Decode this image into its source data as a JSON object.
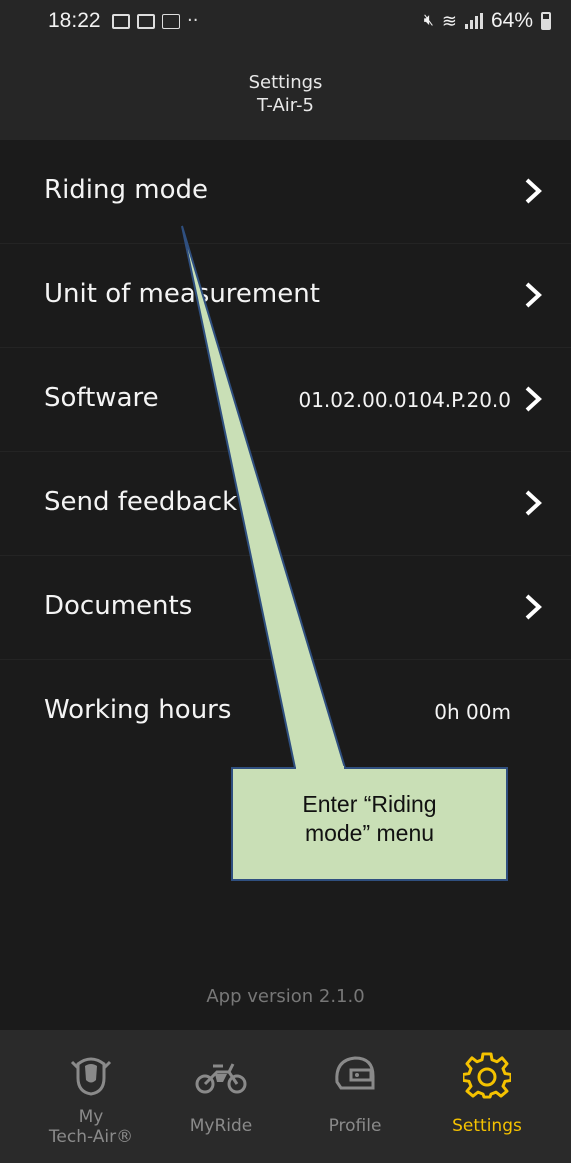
{
  "status_bar": {
    "time": "18:22",
    "battery": "64%",
    "icons_left": [
      "gallery-icon",
      "news-icon",
      "tech-air-icon"
    ],
    "dots": "··"
  },
  "header": {
    "title": "Settings",
    "subtitle": "T-Air-5"
  },
  "menu": {
    "riding_mode": "Riding mode",
    "unit": "Unit of measurement",
    "software": "Software",
    "software_value": "01.02.00.0104.P.20.0",
    "feedback": "Send feedback",
    "documents": "Documents",
    "working_hours": "Working hours",
    "working_hours_value": "0h 00m"
  },
  "app_version": "App version 2.1.0",
  "tabs": {
    "my_tech_air_line1": "My",
    "my_tech_air_line2": "Tech-Air®",
    "myride": "MyRide",
    "profile": "Profile",
    "settings": "Settings"
  },
  "callout": {
    "line1": "Enter “Riding",
    "line2": "mode” menu"
  },
  "colors": {
    "accent": "#f5c200",
    "background": "#1b1b1b",
    "header": "#262626",
    "callout_fill": "#c9dfb6",
    "callout_stroke": "#2f4f7f"
  }
}
